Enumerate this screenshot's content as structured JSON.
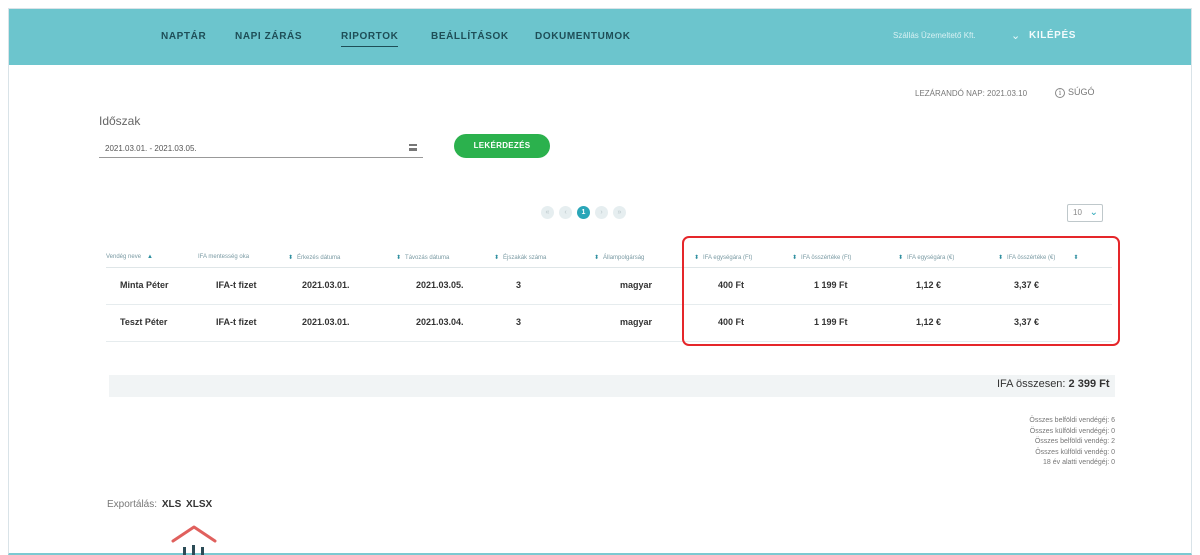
{
  "nav": {
    "items": [
      {
        "label": "NAPTÁR",
        "active": false
      },
      {
        "label": "NAPI ZÁRÁS",
        "active": false
      },
      {
        "label": "RIPORTOK",
        "active": true
      },
      {
        "label": "BEÁLLÍTÁSOK",
        "active": false
      },
      {
        "label": "DOKUMENTUMOK",
        "active": false
      }
    ],
    "user": "Szállás Üzemeltető Kft.",
    "logout": "KILÉPÉS"
  },
  "status": {
    "closing_day": "LEZÁRANDÓ NAP: 2021.03.10",
    "help": "SÚGÓ"
  },
  "filter": {
    "period_label": "Időszak",
    "period_value": "2021.03.01. - 2021.03.05.",
    "query_button": "LEKÉRDEZÉS"
  },
  "pagination": {
    "pages": [
      "«",
      "‹",
      "1",
      "›",
      "»"
    ],
    "current_index": 2,
    "page_size": "10"
  },
  "table": {
    "columns": [
      "Vendég neve",
      "IFA mentesség oka",
      "Érkezés dátuma",
      "Távozás dátuma",
      "Éjszakák száma",
      "Állampolgárság",
      "IFA egységára (Ft)",
      "IFA összértéke (Ft)",
      "IFA egységára (€)",
      "IFA összértéke (€)"
    ],
    "rows": [
      [
        "Minta Péter",
        "IFA-t fizet",
        "2021.03.01.",
        "2021.03.05.",
        "3",
        "magyar",
        "400 Ft",
        "1 199 Ft",
        "1,12 €",
        "3,37 €"
      ],
      [
        "Teszt Péter",
        "IFA-t fizet",
        "2021.03.01.",
        "2021.03.04.",
        "3",
        "magyar",
        "400 Ft",
        "1 199 Ft",
        "1,12 €",
        "3,37 €"
      ]
    ]
  },
  "summary": {
    "vat_label": "IFA összesen:",
    "vat_value": "2 399 Ft",
    "guest_stats": [
      "Összes belföldi vendégéj: 6",
      "Összes külföldi vendégéj: 0",
      "Összes belföldi vendég: 2",
      "Összes külföldi vendég: 0",
      "18 év alatti vendégéj: 0"
    ]
  },
  "export": {
    "label": "Exportálás:",
    "formats": [
      "XLS",
      "XLSX"
    ]
  },
  "colors": {
    "topbar": "#6cc5cd",
    "accent_green": "#2bb14d",
    "accent_teal": "#2aa6b8",
    "highlight_red": "#e5262a"
  }
}
